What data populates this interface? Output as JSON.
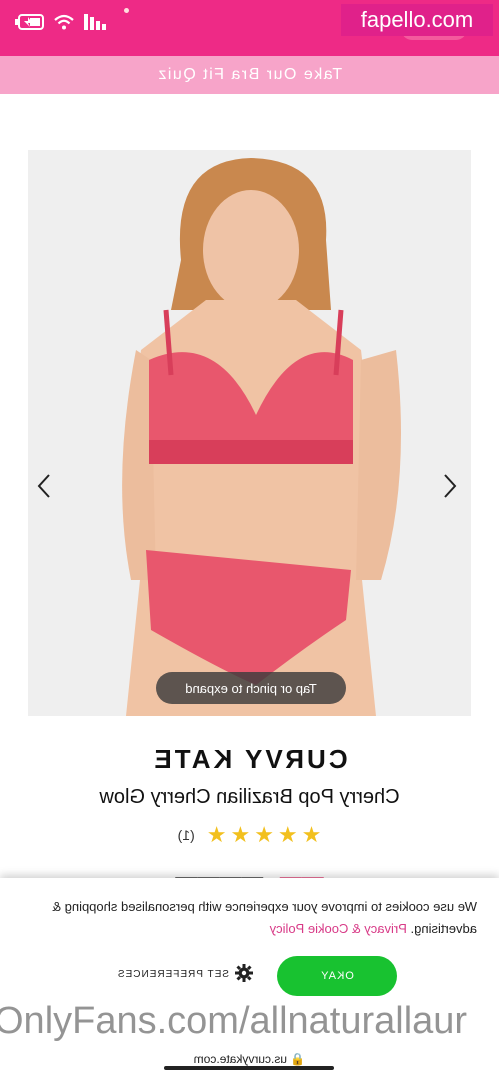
{
  "status_bar": {
    "wifi_icon": "wifi-icon",
    "signal_icon": "signal-icon",
    "battery_icon": "battery-charging-icon"
  },
  "promo": {
    "text": "Take Our Bra Fit Quiz"
  },
  "gallery": {
    "hint": "Tap or pinch to expand",
    "prev_icon": "chevron-left-icon",
    "next_icon": "chevron-right-icon",
    "image": "product-photo"
  },
  "product": {
    "brand": "CURVY KATE",
    "name": "Cherry Pop Brazilian Cherry Glow",
    "rating_stars": 5,
    "rating_count": "(1)"
  },
  "cookie": {
    "text": "We use cookies to improve your experience with personalised shopping & advertising.",
    "link": "Privacy & Cookie Policy",
    "okay_label": "OKAY",
    "prefs_label": "SET PREFERENCES"
  },
  "browser": {
    "url": "us.curvykate.com"
  },
  "watermarks": {
    "top": "fapello.com",
    "bottom": "OnlyFans.com/allnaturallaur"
  },
  "colors": {
    "brand_pink": "#ee2a86",
    "promo_pink": "#f7a4c9",
    "okay_green": "#18c230",
    "star_gold": "#f2c01e"
  }
}
